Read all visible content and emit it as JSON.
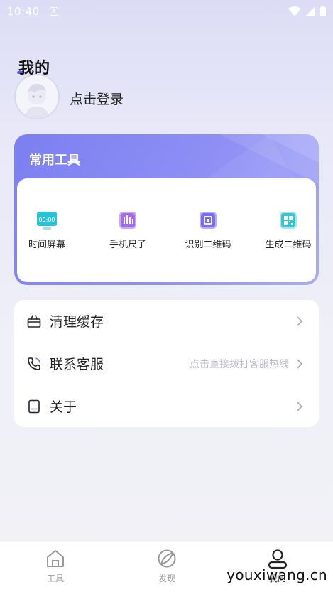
{
  "status_bar": {
    "time": "10:40",
    "notif_glyph": "A"
  },
  "profile": {
    "title": "我的",
    "login_text": "点击登录"
  },
  "tools": {
    "title": "常用工具",
    "items": [
      {
        "label": "时间屏幕",
        "icon": "clock-screen-icon",
        "icon_text": "00:00",
        "color": "#2bc1d6"
      },
      {
        "label": "手机尺子",
        "icon": "ruler-icon",
        "color": "#a46ce8"
      },
      {
        "label": "识别二维码",
        "icon": "scan-qr-icon",
        "color": "#7a6cf0"
      },
      {
        "label": "生成二维码",
        "icon": "qr-code-icon",
        "color": "#3cc3cf"
      }
    ]
  },
  "menu": [
    {
      "label": "清理缓存",
      "icon": "basket-icon",
      "hint": ""
    },
    {
      "label": "联系客服",
      "icon": "phone-icon",
      "hint": "点击直接拨打客服热线"
    },
    {
      "label": "关于",
      "icon": "book-icon",
      "hint": ""
    }
  ],
  "tabs": [
    {
      "label": "工具",
      "icon": "home-icon",
      "active": false
    },
    {
      "label": "发现",
      "icon": "discover-icon",
      "active": false
    },
    {
      "label": "我的",
      "icon": "user-icon",
      "active": true
    }
  ],
  "watermark": "youxiwang.cn",
  "colors": {
    "accent": "#6f73ee",
    "background": "#ececf8"
  }
}
